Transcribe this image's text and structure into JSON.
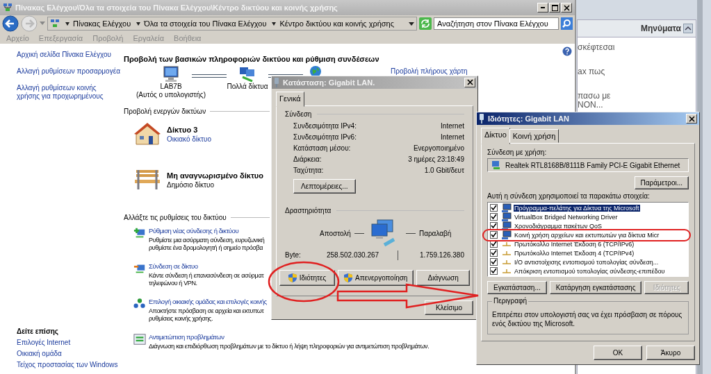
{
  "main_window": {
    "title": "Πίνακας Ελέγχου\\Όλα τα στοιχεία του Πίνακα Ελέγχου\\Κέντρο δικτύου και κοινής χρήσης",
    "breadcrumbs": [
      "Πίνακας Ελέγχου",
      "Όλα τα στοιχεία του Πίνακα Ελέγχου",
      "Κέντρο δικτύου και κοινής χρήσης"
    ],
    "search": {
      "placeholder": "Αναζήτηση στον Πίνακα Ελέγχου"
    },
    "menu": [
      "Αρχείο",
      "Επεξεργασία",
      "Προβολή",
      "Εργαλεία",
      "Βοήθεια"
    ],
    "sidebar": {
      "links": [
        "Αρχική σελίδα Πίνακα Ελέγχου",
        "Αλλαγή ρυθμίσεων προσαρμογέα",
        "Αλλαγή ρυθμίσεων κοινής χρήσης για προχωρημένους"
      ],
      "see_also_title": "Δείτε επίσης",
      "see_also": [
        "Επιλογές Internet",
        "Οικιακή ομάδα",
        "Τείχος προστασίας των Windows"
      ]
    },
    "heading": "Προβολή των βασικών πληροφοριών δικτύου και ρύθμιση συνδέσεων",
    "map_nodes": [
      {
        "label": "LAB7B",
        "sublabel": "(Αυτός ο υπολογιστής)"
      },
      {
        "label": "Πολλά δίκτυα"
      }
    ],
    "full_map_link": "Προβολή πλήρους χάρτη",
    "active_networks_title": "Προβολή ενεργών δικτύων",
    "networks": [
      {
        "kind": "home",
        "name": "Δίκτυο  3",
        "type": "Οικιακό δίκτυο",
        "link": true
      },
      {
        "kind": "public",
        "name": "Μη αναγνωρισμένο δίκτυο",
        "type": "Δημόσιο δίκτυο",
        "link": false
      }
    ],
    "change_settings_title": "Αλλάξτε τις ρυθμίσεις του δικτύου",
    "tasks": [
      {
        "kind": "new",
        "title": "Ρύθμιση νέας σύνδεσης ή δικτύου",
        "description": [
          "Ρυθμίστε μια ασύρματη σύνδεση, ευρυζωνική",
          "ρυθμίστε ένα δρομολογητή ή σημείο πρόσβα"
        ]
      },
      {
        "kind": "connect",
        "title": "Σύνδεση σε δίκτυο",
        "description": [
          "Κάντε σύνδεση ή επανασύνδεση σε ασύρματ",
          "τηλεφώνου ή VPN."
        ]
      },
      {
        "kind": "homegroup",
        "title": "Επιλογή οικιακής ομάδας και επιλογές κοινής",
        "description": [
          "Αποκτήστε πρόσβαση σε αρχεία και εκτυπωτ",
          "ρυθμίσεις κοινής χρήσης."
        ]
      },
      {
        "kind": "troubleshoot",
        "title": "Αντιμετώπιση προβλημάτων",
        "description": [
          "Διάγνωση και επιδιόρθωση προβλημάτων με το δίκτυο ή λήψη πληροφοριών για αντιμετώπιση προβλημάτων."
        ]
      }
    ]
  },
  "background_page": {
    "panel_title": "Μηνύματα",
    "messages": [
      {
        "lines": [
          "σκέφτεσαι"
        ]
      },
      {
        "lines": [
          "ax πως"
        ]
      },
      {
        "lines": [
          "πασω με",
          "NON..."
        ]
      }
    ]
  },
  "status_dialog": {
    "title": "Κατάσταση: Gigabit LAN.",
    "tabs": [
      {
        "label": "Γενικά",
        "selected": true
      }
    ],
    "connection_title": "Σύνδεση",
    "connection_rows": [
      {
        "label": "Συνδεσιμότητα IPv4:",
        "value": "Internet"
      },
      {
        "label": "Συνδεσιμότητα IPv6:",
        "value": "Internet"
      },
      {
        "label": "Κατάσταση μέσου:",
        "value": "Ενεργοποιημένο"
      },
      {
        "label": "Διάρκεια:",
        "value": "3 ημέρες 23:18:49"
      },
      {
        "label": "Ταχύτητα:",
        "value": "1.0 Gbit/δευτ"
      }
    ],
    "details_button": "Λεπτομέρειες...",
    "activity_title": "Δραστηριότητα",
    "sent_label": "Αποστολή",
    "received_label": "Παραλαβή",
    "bytes_label": "Byte:",
    "bytes_sent": "258.502.030.267",
    "bytes_received": "1.759.126.380",
    "buttons": [
      {
        "label": "Ιδιότητες",
        "shield": true
      },
      {
        "label": "Απενεργοποίηση",
        "shield": true
      },
      {
        "label": "Διάγνωση",
        "shield": false
      }
    ],
    "close_button": "Κλείσιμο"
  },
  "properties_dialog": {
    "title": "Ιδιότητες: Gigabit LAN",
    "tabs": [
      {
        "label": "Δίκτυο",
        "selected": true
      },
      {
        "label": "Κοινή χρήση",
        "selected": false
      }
    ],
    "connect_using_label": "Σύνδεση με χρήση:",
    "adapter": "Realtek RTL8168B/8111B Family PCI-E Gigabit Ethernet",
    "configure_button": "Παράμετροι...",
    "items_label": "Αυτή η σύνδεση χρησιμοποιεί τα παρακάτω στοιχεία:",
    "items": [
      {
        "kind": "client",
        "label": "Πρόγραμμα-πελάτης για Δίκτυα της Microsoft",
        "checked": true,
        "selected": true
      },
      {
        "kind": "client",
        "label": "VirtualBox Bridged Networking Driver",
        "checked": true,
        "selected": false
      },
      {
        "kind": "client",
        "label": "Χρονοδιάγραμμα πακέτων QoS",
        "checked": true,
        "selected": false
      },
      {
        "kind": "client",
        "label": "Κοινή χρήση αρχείων και εκτυπωτών για δίκτυα Micr",
        "checked": true,
        "selected": false
      },
      {
        "kind": "protocol",
        "label": "Πρωτόκολλο Internet Έκδοση 6 (TCP/IPv6)",
        "checked": true,
        "selected": false
      },
      {
        "kind": "protocol",
        "label": "Πρωτόκολλο Internet Έκδοση 4 (TCP/IPv4)",
        "checked": true,
        "selected": false
      },
      {
        "kind": "protocol",
        "label": "I/O αντιστοίχισης εντοπισμού τοπολογίας σύνδεση...",
        "checked": true,
        "selected": false
      },
      {
        "kind": "protocol",
        "label": "Απόκριση εντοπισμού τοπολογίας σύνδεσης-επιπέδου",
        "checked": true,
        "selected": false
      }
    ],
    "buttons": [
      {
        "label": "Εγκατάσταση...",
        "disabled": false
      },
      {
        "label": "Κατάργηση εγκατάστασης",
        "disabled": false
      },
      {
        "label": "Ιδιότητες",
        "disabled": true
      }
    ],
    "description_title": "Περιγραφή",
    "description": "Επιτρέπει στον υπολογιστή σας να έχει πρόσβαση σε πόρους ενός δικτύου της Microsoft.",
    "ok_button": "OK",
    "cancel_button": "Άκυρο"
  }
}
